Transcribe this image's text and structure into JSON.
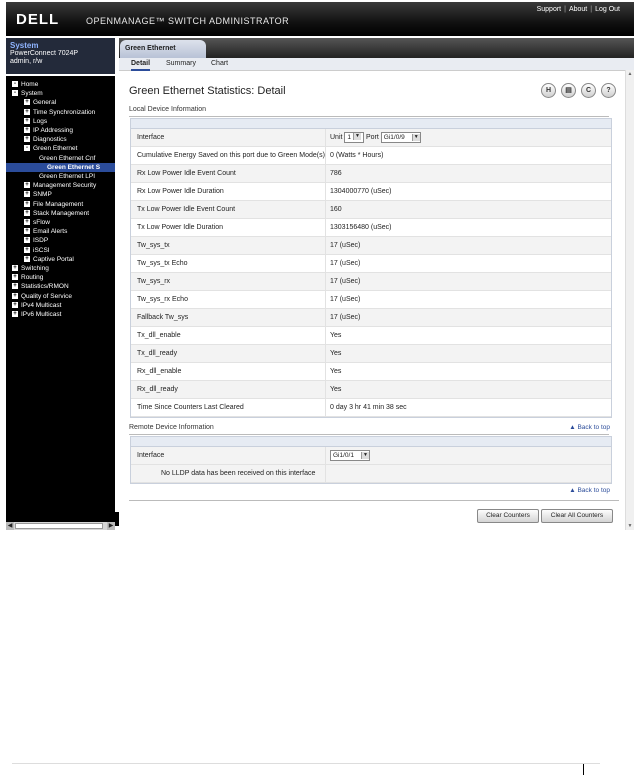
{
  "header": {
    "logo": "DELL",
    "product": "OPENMANAGE™ SWITCH ADMINISTRATOR",
    "links": [
      "Support",
      "About",
      "Log Out"
    ]
  },
  "system_info": {
    "title": "System",
    "model": "PowerConnect 7024P",
    "user": "admin, r/w"
  },
  "nav": {
    "items": [
      {
        "label": "Home",
        "depth": 0,
        "box": "-"
      },
      {
        "label": "System",
        "depth": 0,
        "box": "-"
      },
      {
        "label": "General",
        "depth": 1,
        "box": "+"
      },
      {
        "label": "Time Synchronization",
        "depth": 1,
        "box": "+"
      },
      {
        "label": "Logs",
        "depth": 1,
        "box": "+"
      },
      {
        "label": "IP Addressing",
        "depth": 1,
        "box": "+"
      },
      {
        "label": "Diagnostics",
        "depth": 1,
        "box": "+"
      },
      {
        "label": "Green Ethernet",
        "depth": 1,
        "box": "-"
      },
      {
        "label": "Green Ethernet Cnf",
        "depth": 2,
        "box": ""
      },
      {
        "label": "Green Ethernet S",
        "depth": 2,
        "box": "",
        "selected": true
      },
      {
        "label": "Green Ethernet LPI",
        "depth": 2,
        "box": ""
      },
      {
        "label": "Management Security",
        "depth": 1,
        "box": "+"
      },
      {
        "label": "SNMP",
        "depth": 1,
        "box": "+"
      },
      {
        "label": "File Management",
        "depth": 1,
        "box": "+"
      },
      {
        "label": "Stack Management",
        "depth": 1,
        "box": "+"
      },
      {
        "label": "sFlow",
        "depth": 1,
        "box": "+"
      },
      {
        "label": "Email Alerts",
        "depth": 1,
        "box": "+"
      },
      {
        "label": "ISDP",
        "depth": 1,
        "box": "+"
      },
      {
        "label": "iSCSI",
        "depth": 1,
        "box": "+"
      },
      {
        "label": "Captive Portal",
        "depth": 1,
        "box": "+"
      },
      {
        "label": "Switching",
        "depth": 0,
        "box": "+"
      },
      {
        "label": "Routing",
        "depth": 0,
        "box": "+"
      },
      {
        "label": "Statistics/RMON",
        "depth": 0,
        "box": "+"
      },
      {
        "label": "Quality of Service",
        "depth": 0,
        "box": "+"
      },
      {
        "label": "IPv4 Multicast",
        "depth": 0,
        "box": "+"
      },
      {
        "label": "IPv6 Multicast",
        "depth": 0,
        "box": "+"
      }
    ]
  },
  "tab": {
    "label": "Green Ethernet Statistics"
  },
  "subtabs": [
    "Detail",
    "Summary",
    "Chart"
  ],
  "page": {
    "title": "Green Ethernet Statistics: Detail",
    "icons": [
      "save-icon",
      "print-icon",
      "refresh-icon",
      "help-icon"
    ]
  },
  "local": {
    "section_title": "Local Device Information",
    "interface_label": "Interface",
    "unit_label": "Unit",
    "unit_value": "1",
    "port_label": "Port",
    "port_value": "Gi1/0/9",
    "rows": [
      {
        "label": "Cumulative Energy Saved on this port due to Green Mode(s)",
        "value": "0  (Watts * Hours)"
      },
      {
        "label": "Rx Low Power Idle Event Count",
        "value": "786"
      },
      {
        "label": "Rx Low Power Idle Duration",
        "value": "1304000770   (uSec)"
      },
      {
        "label": "Tx Low Power Idle Event Count",
        "value": "160"
      },
      {
        "label": "Tx Low Power Idle Duration",
        "value": "1303156480   (uSec)"
      },
      {
        "label": "Tw_sys_tx",
        "value": "17   (uSec)"
      },
      {
        "label": "Tw_sys_tx Echo",
        "value": "17   (uSec)"
      },
      {
        "label": "Tw_sys_rx",
        "value": "17   (uSec)"
      },
      {
        "label": "Tw_sys_rx Echo",
        "value": "17   (uSec)"
      },
      {
        "label": "Fallback Tw_sys",
        "value": "17   (uSec)"
      },
      {
        "label": "Tx_dll_enable",
        "value": "Yes"
      },
      {
        "label": "Tx_dll_ready",
        "value": "Yes"
      },
      {
        "label": "Rx_dll_enable",
        "value": "Yes"
      },
      {
        "label": "Rx_dll_ready",
        "value": "Yes"
      },
      {
        "label": "Time Since Counters Last Cleared",
        "value": "0 day 3 hr 41 min 38 sec"
      }
    ]
  },
  "remote": {
    "section_title": "Remote Device Information",
    "back_to_top": "Back to top",
    "interface_label": "Interface",
    "interface_value": "Gi1/0/1",
    "message": "No LLDP data has been received on this interface",
    "back_to_top_bottom": "Back to top"
  },
  "buttons": {
    "clear_counters": "Clear Counters",
    "clear_all_counters": "Clear All Counters"
  }
}
